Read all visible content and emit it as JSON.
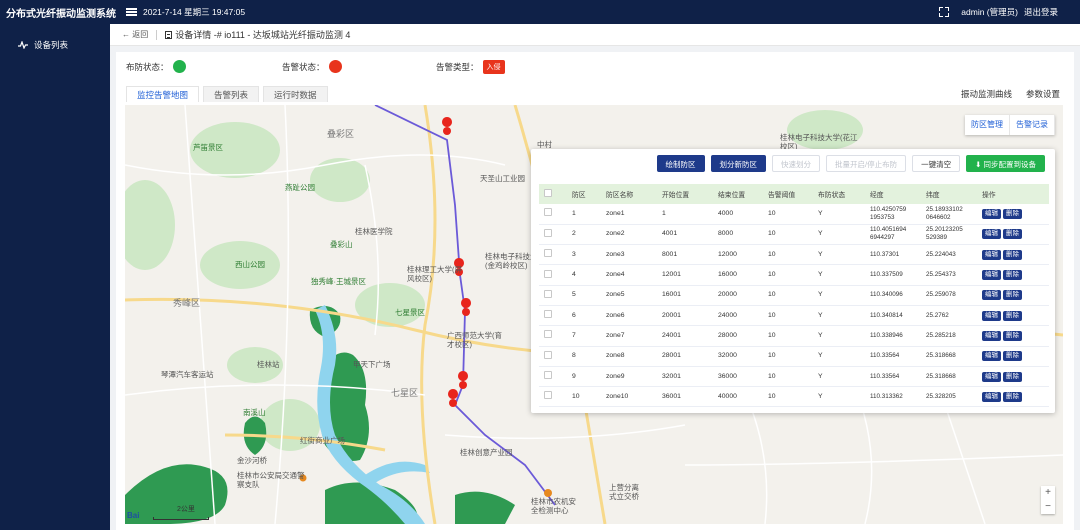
{
  "app": {
    "title": "分布式光纤振动监测系统",
    "datetime": "2021-7-14 星期三 19:47:05",
    "user": "admin (管理员)",
    "logout": "退出登录"
  },
  "sidebar": {
    "items": [
      {
        "label": "设备列表"
      }
    ]
  },
  "breadcrumb": {
    "back": "返回",
    "title": "设备详情 -# io111 - 达坂城站光纤振动监测 4"
  },
  "status": {
    "arm_label": "布防状态：",
    "arm_color": "#22b24c",
    "alarm_label": "告警状态：",
    "alarm_color": "#e8341c",
    "alarm_type_label": "告警类型：",
    "alarm_type_value": "入侵"
  },
  "tabs": [
    "监控告警地图",
    "告警列表",
    "运行时数据"
  ],
  "right_links": [
    "振动监测曲线",
    "参数设置"
  ],
  "map": {
    "controls": [
      "防区管理",
      "告警记录"
    ],
    "zoom_in": "+",
    "zoom_out": "−",
    "scale": "2公里",
    "logo": "Bai",
    "labels": {
      "diecai": "叠彩区",
      "xiufeng": "秀峰区",
      "qixing": "七星区",
      "lunan": "芦笛景区",
      "yaoshan": "桂林电子科技大学(花江校区)",
      "tiansheng": "天圣山工业园",
      "gxnu": "桂林理工大学(屏风校区)",
      "elec": "桂林电子科技大学(金鸡岭校区)",
      "seven": "七星景区",
      "gxnu2": "广西师范大学(育才校区)",
      "guilinzhan": "桂林站",
      "jiaqi": "琴潭汽车客运站",
      "zhongshan": "中山",
      "hongjie": "红街商业广场",
      "jin": "金沙河桥",
      "police": "桂林市公安局交通警察支队",
      "wanda": "桂林万达广场",
      "xixiu": "桂林市公园",
      "moonhill": "南溪山",
      "west": "西山公园",
      "yingchuan": "象鼻山",
      "chuanshan": "穿山",
      "yanghu": "上营分离式立交桥",
      "ag": "桂林市农机安全检测中心",
      "jiancha": "桂林创意产业园",
      "zhongcun": "中村",
      "jiuwan": "甲天下广场",
      "dongfang": "叠彩山",
      "ludi": "伏波山",
      "shuguang": "独秀峰·王城景区",
      "farm": "桂林医学院",
      "heli": "燕趾公园",
      "li": "逍遥楼",
      "ziyou": "靖江王陵"
    }
  },
  "zone_panel": {
    "buttons": {
      "draw": "绘制防区",
      "split": "划分新防区",
      "quick": "快速划分",
      "batch": "批量开启/停止布防",
      "clear": "一键清空",
      "sync": "同步配置到设备"
    },
    "columns": [
      "防区",
      "防区名称",
      "开始位置",
      "结束位置",
      "告警阈值",
      "布防状态",
      "经度",
      "纬度",
      "操作"
    ],
    "edit_label": "编辑",
    "delete_label": "删除",
    "rows": [
      {
        "id": "1",
        "name": "zone1",
        "start": "1",
        "end": "4000",
        "threshold": "10",
        "armed": "Y",
        "lng": "110.4250759 1953753",
        "lat": "25.18933102 0646602"
      },
      {
        "id": "2",
        "name": "zone2",
        "start": "4001",
        "end": "8000",
        "threshold": "10",
        "armed": "Y",
        "lng": "110.4051694 6944297",
        "lat": "25.20123205 529389"
      },
      {
        "id": "3",
        "name": "zone3",
        "start": "8001",
        "end": "12000",
        "threshold": "10",
        "armed": "Y",
        "lng": "110.37301",
        "lat": "25.224043"
      },
      {
        "id": "4",
        "name": "zone4",
        "start": "12001",
        "end": "16000",
        "threshold": "10",
        "armed": "Y",
        "lng": "110.337509",
        "lat": "25.254373"
      },
      {
        "id": "5",
        "name": "zone5",
        "start": "16001",
        "end": "20000",
        "threshold": "10",
        "armed": "Y",
        "lng": "110.340096",
        "lat": "25.259078"
      },
      {
        "id": "6",
        "name": "zone6",
        "start": "20001",
        "end": "24000",
        "threshold": "10",
        "armed": "Y",
        "lng": "110.340814",
        "lat": "25.2762"
      },
      {
        "id": "7",
        "name": "zone7",
        "start": "24001",
        "end": "28000",
        "threshold": "10",
        "armed": "Y",
        "lng": "110.338946",
        "lat": "25.285218"
      },
      {
        "id": "8",
        "name": "zone8",
        "start": "28001",
        "end": "32000",
        "threshold": "10",
        "armed": "Y",
        "lng": "110.33564",
        "lat": "25.318668"
      },
      {
        "id": "9",
        "name": "zone9",
        "start": "32001",
        "end": "36000",
        "threshold": "10",
        "armed": "Y",
        "lng": "110.33564",
        "lat": "25.318668"
      },
      {
        "id": "10",
        "name": "zone10",
        "start": "36001",
        "end": "40000",
        "threshold": "10",
        "armed": "Y",
        "lng": "110.313362",
        "lat": "25.328205"
      }
    ]
  }
}
